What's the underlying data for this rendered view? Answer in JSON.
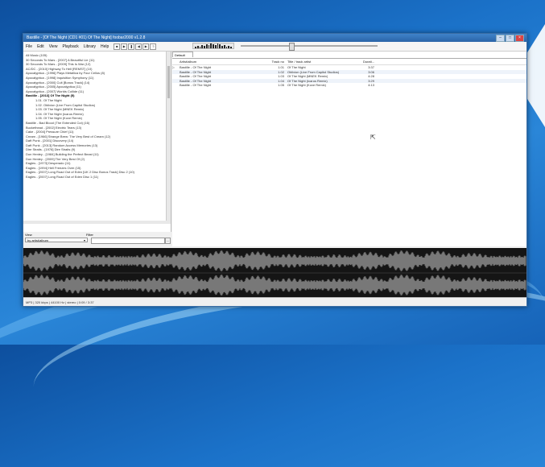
{
  "window": {
    "title": "Bastille - [Of The Night (CD1 #01) Of The Night]  foobar2000 v1.2.8"
  },
  "menu": [
    "File",
    "Edit",
    "View",
    "Playback",
    "Library",
    "Help"
  ],
  "toolbar_icons": [
    "stop-icon",
    "play-icon",
    "pause-icon",
    "prev-icon",
    "next-icon",
    "random-icon"
  ],
  "library": {
    "root": "All Music (105)",
    "items": [
      {
        "label": "30 Seconds To Mars - [2007] A Beautiful Lie (11)",
        "indent": 0
      },
      {
        "label": "30 Seconds To Mars - [2009] This Is War (12)",
        "indent": 0
      },
      {
        "label": "AC/DC - [2010] Highway To Hell [REMST] (10)",
        "indent": 0
      },
      {
        "label": "Apocalyptica - [1996] Plays Metallica by Four Cellos (8)",
        "indent": 0
      },
      {
        "label": "Apocalyptica - [1998] Inquisition Symphony (11)",
        "indent": 0
      },
      {
        "label": "Apocalyptica - [2000] Cult [Bonus Track] (14)",
        "indent": 0
      },
      {
        "label": "Apocalyptica - [2005] Apocalyptica (11)",
        "indent": 0
      },
      {
        "label": "Apocalyptica - [2007] Worlds Collide (11)",
        "indent": 0
      },
      {
        "label": "Bastille - [2013] Of The Night (5)",
        "indent": 0,
        "selected": true
      },
      {
        "label": "1.01. Of The Night",
        "indent": 1
      },
      {
        "label": "1.02. Oblivion (Live From Capitol Studios)",
        "indent": 1
      },
      {
        "label": "1.03. Of The Night (MNEK Remix)",
        "indent": 1
      },
      {
        "label": "1.04. Of The Night (Icarus Remix)",
        "indent": 1
      },
      {
        "label": "1.05. Of The Night (Kove Remix)",
        "indent": 1
      },
      {
        "label": "Bastille - Bad Blood (The Extended Cut) (16)",
        "indent": 0
      },
      {
        "label": "Buckethead - [2002] Electric Tears (13)",
        "indent": 0
      },
      {
        "label": "Cake - [2004] Pressure Chief (11)",
        "indent": 0
      },
      {
        "label": "Cream - [1966] Strange Brew: The Very Best of Cream (12)",
        "indent": 0
      },
      {
        "label": "Daft Punk - [2001] Discovery (14)",
        "indent": 0
      },
      {
        "label": "Daft Punk - [2013] Random Access Memories (13)",
        "indent": 0
      },
      {
        "label": "Dire Straits - [1978] Dire Straits (9)",
        "indent": 0
      },
      {
        "label": "Don Henley - [1984] Building the Perfect Beast (11)",
        "indent": 0
      },
      {
        "label": "Don Henley - [2009] The Very Best Of (2)",
        "indent": 0
      },
      {
        "label": "Eagles - [1973] Desperado (11)",
        "indent": 0
      },
      {
        "label": "Eagles - [1994] Hell Freezes Over (15)",
        "indent": 0
      },
      {
        "label": "Eagles - [2007] Long Road Out of Eden [UK 2 Disc Bonus Track] Disc 2 (10)",
        "indent": 0
      },
      {
        "label": "Eagles - [2007] Long Road Out of Eden Disc 1 (11)",
        "indent": 0
      }
    ]
  },
  "view_panel": {
    "view_label": "View",
    "filter_label": "Filter",
    "view_value": "by artist/album",
    "filter_button": "..."
  },
  "playlist": {
    "tab": "Default",
    "columns": [
      "Artist/album",
      "Track no",
      "Title / track artist",
      "Durati..."
    ],
    "rows": [
      {
        "artist": "Bastille - Of The Night",
        "track": "1.01",
        "title": "Of The Night",
        "duration": "3:37",
        "playing": true
      },
      {
        "artist": "Bastille - Of The Night",
        "track": "1.02",
        "title": "Oblivion (Live From Capitol Studios)",
        "duration": "3:06"
      },
      {
        "artist": "Bastille - Of The Night",
        "track": "1.03",
        "title": "Of The Night (MNEK Remix)",
        "duration": "4:28"
      },
      {
        "artist": "Bastille - Of The Night",
        "track": "1.04",
        "title": "Of The Night (Icarus Remix)",
        "duration": "3:29"
      },
      {
        "artist": "Bastille - Of The Night",
        "track": "1.05",
        "title": "Of The Night (Kove Remix)",
        "duration": "4:13"
      }
    ]
  },
  "status": "MP3 | 320 kbps | 44100 Hz | stereo | 0:09 / 3:37",
  "colors": {
    "titlebar": "#2a64a8",
    "desktop": "#1b72c9",
    "waveform_bg": "#151515"
  }
}
